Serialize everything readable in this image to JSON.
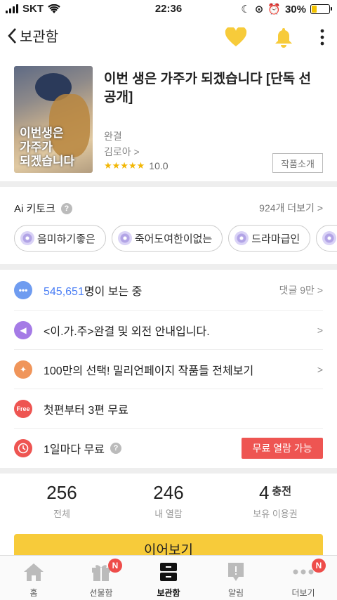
{
  "status_bar": {
    "carrier": "SKT",
    "time": "22:36",
    "battery": "30%"
  },
  "nav": {
    "back_label": "보관함",
    "icons": [
      "heart-icon",
      "bell-icon",
      "more-vertical-icon"
    ],
    "accent": "#f7cb3a"
  },
  "book": {
    "title": "이번 생은 가주가 되겠습니다 [단독 선공개]",
    "status": "완결",
    "author": "김로아 >",
    "stars": "★★★★★",
    "rating": "10.0",
    "intro_button": "작품소개"
  },
  "keywords": {
    "label": "Ai 키토크",
    "help": "?",
    "more": "924개 더보기 >",
    "items": [
      "음미하기좋은",
      "죽어도여한이없는",
      "드라마급인",
      ""
    ]
  },
  "info_rows": {
    "viewers": {
      "count": "545,651",
      "suffix": "명이 보는 중",
      "right": "댓글 9만 >"
    },
    "notice": {
      "text": "<이.가.주>완결 및 외전 안내입니다.",
      "right": ">"
    },
    "promo": {
      "text": "100만의 선택! 밀리언페이지 작품들 전체보기",
      "right": ">"
    },
    "free_first": {
      "icon_text": "Free",
      "text": "첫편부터 3편 무료"
    },
    "daily_free": {
      "text": "1일마다 무료",
      "help": "?",
      "button": "무료 열람 가능"
    }
  },
  "stats": [
    {
      "value": "256",
      "extra": "",
      "label": "전체"
    },
    {
      "value": "246",
      "extra": "",
      "label": "내 열람"
    },
    {
      "value": "4",
      "extra": "충전",
      "label": "보유 이용권"
    }
  ],
  "continue_button": "이어보기",
  "tabs": [
    {
      "label": "홈",
      "icon": "home-icon",
      "badge": ""
    },
    {
      "label": "선물함",
      "icon": "gift-icon",
      "badge": "N"
    },
    {
      "label": "보관함",
      "icon": "library-icon",
      "badge": ""
    },
    {
      "label": "알림",
      "icon": "notification-icon",
      "badge": ""
    },
    {
      "label": "더보기",
      "icon": "more-dots-icon",
      "badge": "N"
    }
  ],
  "colors": {
    "primary_yellow": "#f7cb3a",
    "link_blue": "#4a7ef5",
    "red": "#ee5552"
  }
}
